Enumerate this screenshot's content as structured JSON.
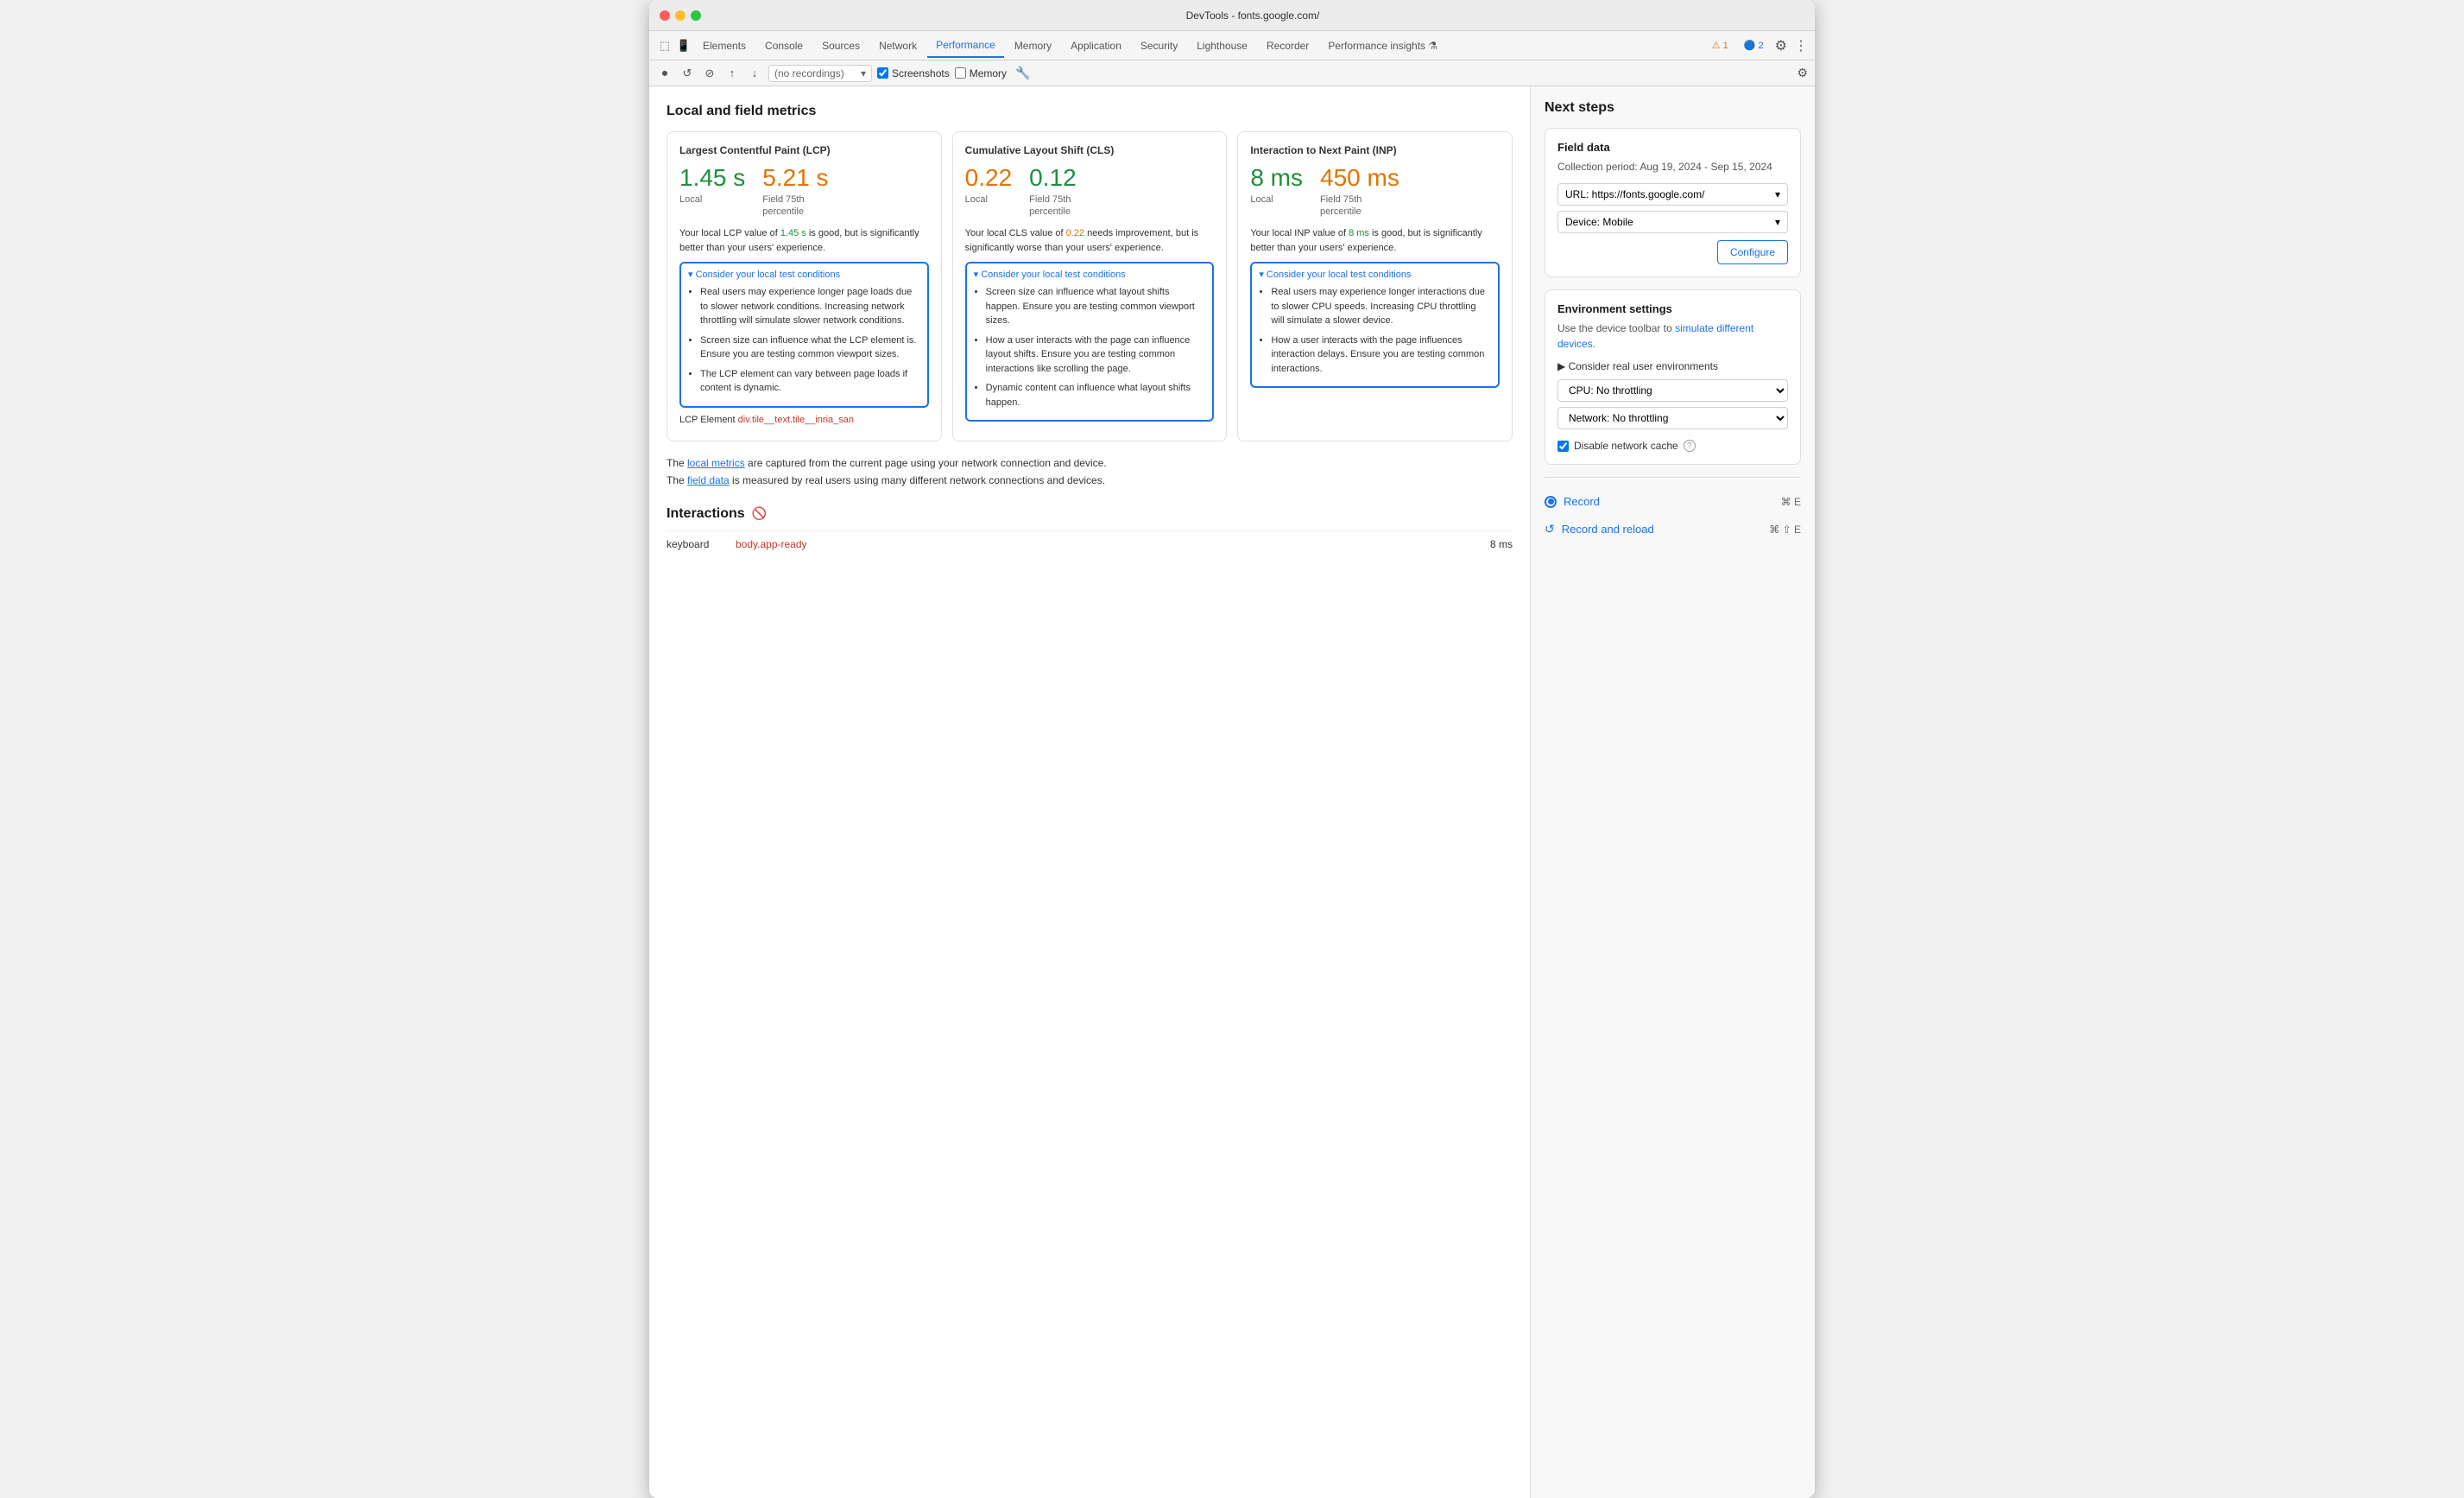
{
  "window": {
    "title": "DevTools - fonts.google.com/"
  },
  "tabs": {
    "items": [
      {
        "label": "Elements",
        "active": false
      },
      {
        "label": "Console",
        "active": false
      },
      {
        "label": "Sources",
        "active": false
      },
      {
        "label": "Network",
        "active": false
      },
      {
        "label": "Performance",
        "active": true
      },
      {
        "label": "Memory",
        "active": false
      },
      {
        "label": "Application",
        "active": false
      },
      {
        "label": "Security",
        "active": false
      },
      {
        "label": "Lighthouse",
        "active": false
      },
      {
        "label": "Recorder",
        "active": false
      },
      {
        "label": "Performance insights ⚗",
        "active": false
      }
    ],
    "alert_warning": "⚠ 1",
    "alert_info": "🔵 2"
  },
  "toolbar": {
    "record_placeholder": "(no recordings)",
    "screenshots_label": "Screenshots",
    "memory_label": "Memory"
  },
  "content": {
    "section_title": "Local and field metrics",
    "metrics": [
      {
        "title": "Largest Contentful Paint (LCP)",
        "local_value": "1.45 s",
        "local_color": "green",
        "field_value": "5.21 s",
        "field_color": "orange",
        "field_label": "Field 75th\npercentile",
        "local_label": "Local",
        "description": "Your local LCP value of 1.45 s is good, but is significantly better than your users' experience.",
        "desc_highlight": "1.45 s",
        "desc_highlight_color": "green",
        "consider_title": "▾ Consider your local test conditions",
        "consider_items": [
          "Real users may experience longer page loads due to slower network conditions. Increasing network throttling will simulate slower network conditions.",
          "Screen size can influence what the LCP element is. Ensure you are testing common viewport sizes.",
          "The LCP element can vary between page loads if content is dynamic."
        ],
        "extra": "LCP Element",
        "extra_value": "div.tile__text.tile__inria_san"
      },
      {
        "title": "Cumulative Layout Shift (CLS)",
        "local_value": "0.22",
        "local_color": "orange",
        "field_value": "0.12",
        "field_color": "green",
        "field_label": "Field 75th\npercentile",
        "local_label": "Local",
        "description": "Your local CLS value of 0.22 needs improvement, but is significantly worse than your users' experience.",
        "desc_highlight": "0.22",
        "desc_highlight_color": "orange",
        "consider_title": "▾ Consider your local test conditions",
        "consider_items": [
          "Screen size can influence what layout shifts happen. Ensure you are testing common viewport sizes.",
          "How a user interacts with the page can influence layout shifts. Ensure you are testing common interactions like scrolling the page.",
          "Dynamic content can influence what layout shifts happen."
        ]
      },
      {
        "title": "Interaction to Next Paint (INP)",
        "local_value": "8 ms",
        "local_color": "green",
        "field_value": "450 ms",
        "field_color": "orange",
        "field_label": "Field 75th\npercentile",
        "local_label": "Local",
        "description": "Your local INP value of 8 ms is good, but is significantly better than your users' experience.",
        "desc_highlight": "8 ms",
        "desc_highlight_color": "green",
        "consider_title": "▾ Consider your local test conditions",
        "consider_items": [
          "Real users may experience longer interactions due to slower CPU speeds. Increasing CPU throttling will simulate a slower device.",
          "How a user interacts with the page influences interaction delays. Ensure you are testing common interactions."
        ]
      }
    ],
    "footer_text1": "The local metrics are captured from the current page using your network connection and device.",
    "footer_text2": "The field data is measured by real users using many different network connections and devices.",
    "footer_link1": "local metrics",
    "footer_link2": "field data",
    "interactions": {
      "title": "Interactions",
      "rows": [
        {
          "name": "keyboard",
          "element": "body.app-ready",
          "time": "8 ms"
        }
      ]
    }
  },
  "sidebar": {
    "title": "Next steps",
    "field_data": {
      "title": "Field data",
      "collection_period": "Collection period: Aug 19, 2024 - Sep 15, 2024",
      "url_label": "URL: https://fonts.google.com/",
      "device_label": "Device: Mobile",
      "configure_label": "Configure"
    },
    "env_settings": {
      "title": "Environment settings",
      "description": "Use the device toolbar to",
      "link_text": "simulate different devices",
      "link_end": ".",
      "consider_label": "▶ Consider real user environments",
      "cpu_label": "CPU: No throttling",
      "network_label": "Network: No throttling",
      "disable_cache_label": "Disable network cache"
    },
    "record": {
      "label": "Record",
      "shortcut": "⌘ E",
      "reload_label": "Record and reload",
      "reload_shortcut": "⌘ ⇧ E"
    }
  }
}
